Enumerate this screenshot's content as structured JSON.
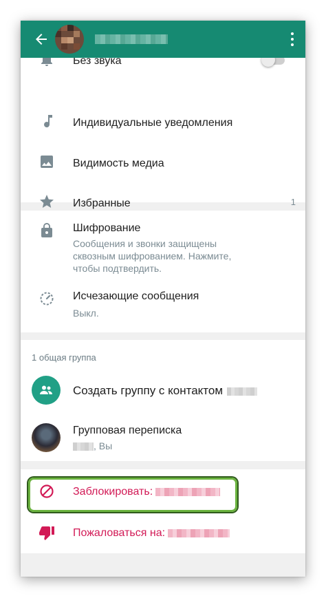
{
  "colors": {
    "accent": "#168a72",
    "danger": "#d21a56",
    "highlight": "#6bb33f"
  },
  "appbar": {
    "back_icon": "arrow-left-icon",
    "menu_icon": "more-vert-icon"
  },
  "settings": [
    {
      "label": "Без звука",
      "icon": "bell-icon",
      "toggle": false
    },
    {
      "label": "Индивидуальные уведомления",
      "icon": "music-note-icon"
    },
    {
      "label": "Видимость медиа",
      "icon": "image-icon"
    },
    {
      "label": "Избранные",
      "icon": "star-icon",
      "count": "1"
    }
  ],
  "security": {
    "encryption": {
      "title": "Шифрование",
      "desc": [
        "Сообщения и звонки защищены",
        "сквозным шифрованием. Нажмите,",
        "чтобы подтвердить."
      ],
      "icon": "lock-icon"
    },
    "disappearing": {
      "title": "Исчезающие сообщения",
      "value": "Выкл.",
      "icon": "timer-icon"
    }
  },
  "groups": {
    "caption": "1 общая группа",
    "create": {
      "label": "Создать группу с контактом",
      "icon": "group-add-icon"
    },
    "group": {
      "title": "Групповая переписка",
      "members": ", Вы"
    }
  },
  "actions": {
    "block": {
      "label": "Заблокировать:",
      "icon": "block-icon"
    },
    "report": {
      "label": "Пожаловаться на:",
      "icon": "thumb-down-icon"
    }
  }
}
